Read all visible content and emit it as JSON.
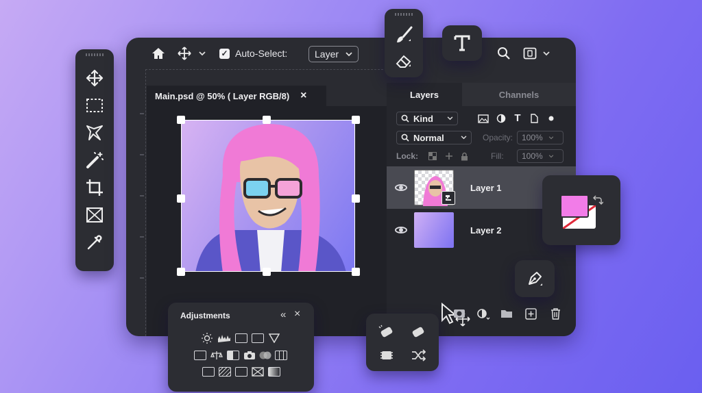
{
  "toolbar": {
    "auto_select_label": "Auto-Select:",
    "layer_select_value": "Layer",
    "auto_select_checked": true
  },
  "document": {
    "tab_title": "Main.psd @ 50% ( Layer RGB/8)",
    "close_glyph": "×"
  },
  "layers_panel": {
    "tabs": [
      {
        "label": "Layers",
        "active": true
      },
      {
        "label": "Channels",
        "active": false
      }
    ],
    "filter_label": "Kind",
    "blend_mode": "Normal",
    "opacity_label": "Opacity:",
    "opacity_value": "100%",
    "lock_label": "Lock:",
    "fill_label": "Fill:",
    "fill_value": "100%",
    "layers": [
      {
        "name": "Layer 1",
        "selected": true
      },
      {
        "name": "Layer 2",
        "selected": false
      }
    ]
  },
  "adjustments": {
    "title": "Adjustments",
    "collapse_glyph": "«",
    "close_glyph": "×"
  },
  "colors": {
    "accent_pink": "#f27ce8",
    "panel_bg": "#25262c",
    "window_bg": "#2a2b31"
  }
}
